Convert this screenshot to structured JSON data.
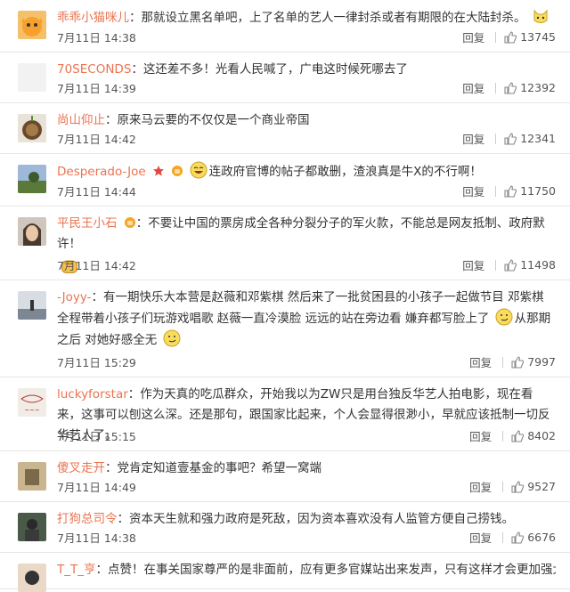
{
  "comments": [
    {
      "user": "乖乖小猫咪儿",
      "text": "：那就设立黑名单吧，上了名单的艺人一律封杀或者有期限的在大陆封杀。",
      "time": "7月11日 14:38",
      "reply": "回复",
      "likes": "13745"
    },
    {
      "user": "70SECONDS",
      "text": "：这还差不多！光看人民喊了，广电这时候死哪去了",
      "time": "7月11日 14:39",
      "reply": "回复",
      "likes": "12392"
    },
    {
      "user": "尚山仰止",
      "text": "：原来马云要的不仅仅是一个商业帝国",
      "time": "7月11日 14:42",
      "reply": "回复",
      "likes": "12341"
    },
    {
      "user": "Desperado-Joe",
      "text": "连政府官博的帖子都敢删，渣浪真是牛X的不行啊！",
      "time": "7月11日 14:44",
      "reply": "回复",
      "likes": "11750"
    },
    {
      "user": "平民王小石",
      "text": "：不要让中国的票房成全各种分裂分子的军火款，不能总是网友抵制、政府默许！",
      "time": "7月11日 14:42",
      "reply": "回复",
      "likes": "11498"
    },
    {
      "user": "-Joyy-",
      "text": "：有一期快乐大本营是赵薇和邓紫棋 然后来了一批贫困县的小孩子一起做节目 邓紫棋全程带着小孩子们玩游戏唱歌 赵薇一直冷漠脸 远远的站在旁边看 嫌弃都写脸上了",
      "text2": "从那期之后 对她好感全无",
      "time": "7月11日 15:29",
      "reply": "回复",
      "likes": "7997"
    },
    {
      "user": "luckyforstar",
      "text": "：作为天真的吃瓜群众，开始我以为ZW只是用台独反华艺人拍电影，现在看来，这事可以刨这么深。还是那句，跟国家比起来，个人会显得很渺小，早就应该抵制一切反华艺人了。",
      "time": "7月11日 15:15",
      "reply": "回复",
      "likes": "8402"
    },
    {
      "user": "傻叉走开",
      "text": "：党肯定知道壹基金的事吧？希望一窝端",
      "time": "7月11日 14:49",
      "reply": "回复",
      "likes": "9527"
    },
    {
      "user": "打狗总司令",
      "text": "：资本天生就和强力政府是死敌，因为资本喜欢没有人监管方便自己捞钱。",
      "time": "7月11日 14:38",
      "reply": "回复",
      "likes": "6676"
    },
    {
      "user": "T_T_亨",
      "text": "：点赞！在事关国家尊严的是非面前，应有更多官媒站出来发声，只有这样才会更加强大！",
      "time": "",
      "reply": "",
      "likes": ""
    }
  ],
  "icons": {
    "like": "thumbs-up-icon",
    "reaction": "emoji-icon"
  },
  "colors": {
    "username": "#eb7350",
    "text": "#333333",
    "divider": "#e6e6e6"
  }
}
